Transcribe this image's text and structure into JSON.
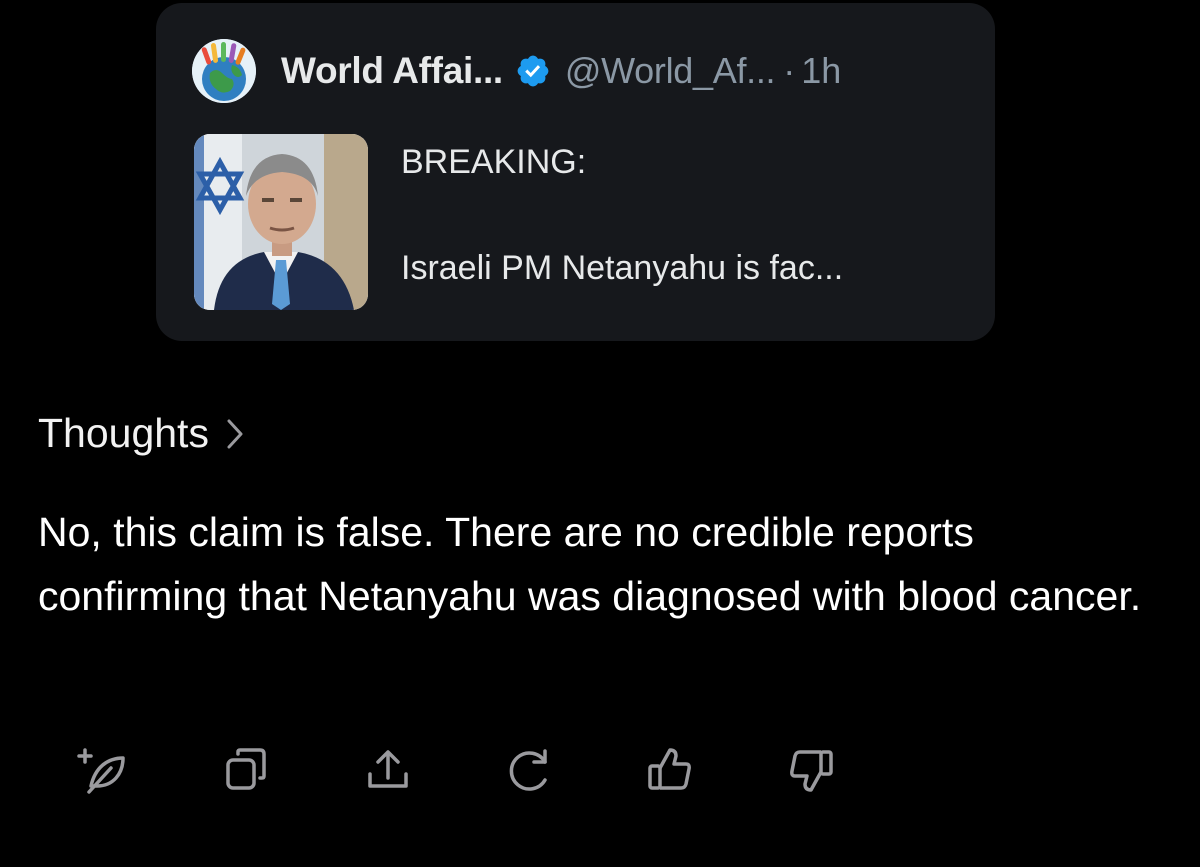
{
  "quoted_post": {
    "author_name": "World Affai...",
    "handle": "@World_Af...",
    "separator": "·",
    "time": "1h",
    "text_line1": "BREAKING:",
    "text_line2": "Israeli PM Netanyahu is fac..."
  },
  "thoughts": {
    "label": "Thoughts"
  },
  "answer": {
    "text": "No, this claim is false. There are no credible reports confirming that Netanyahu was diagnosed with blood cancer."
  },
  "actions": [
    {
      "icon": "new-thread-icon"
    },
    {
      "icon": "copy-icon"
    },
    {
      "icon": "share-icon"
    },
    {
      "icon": "regenerate-icon"
    },
    {
      "icon": "thumbs-up-icon"
    },
    {
      "icon": "thumbs-down-icon"
    }
  ],
  "colors": {
    "background": "#000000",
    "card": "#16181c",
    "verified_blue": "#1d9bf0",
    "muted": "#8b98a5",
    "icon": "#9a9a9e"
  }
}
